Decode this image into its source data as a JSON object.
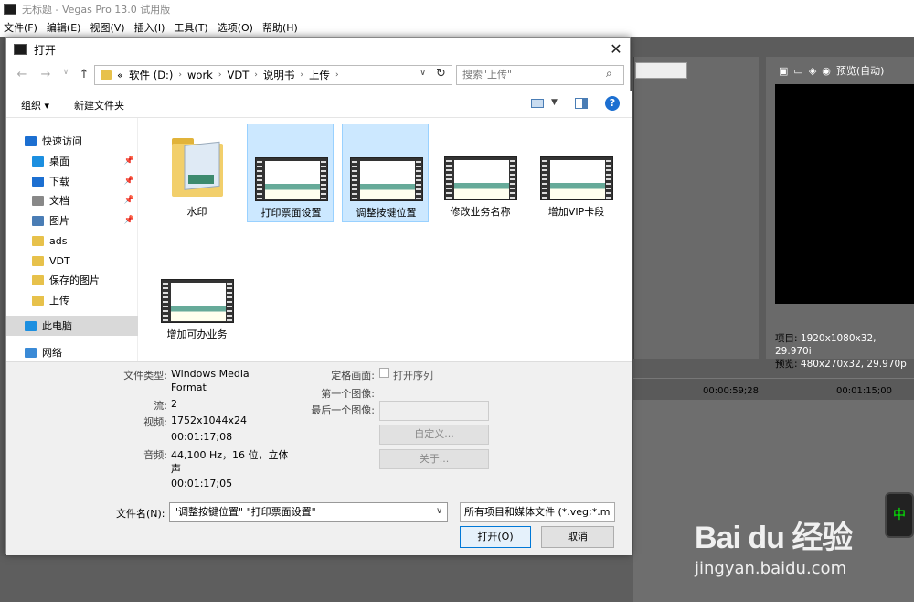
{
  "app": {
    "title": "无标题 - Vegas Pro 13.0 试用版",
    "menu": [
      "文件(F)",
      "编辑(E)",
      "视图(V)",
      "插入(I)",
      "工具(T)",
      "选项(O)",
      "帮助(H)"
    ],
    "preview_label": "预览(自动)",
    "project_label": "项目:",
    "project_value": "1920x1080x32, 29.970i",
    "preview_info_label": "预览:",
    "preview_info_value": "480x270x32, 29.970p",
    "ruler": [
      "00:00:59;28",
      "00:01:15;00"
    ],
    "float_btn": "中"
  },
  "watermark": {
    "brand": "Bai du 经验",
    "url": "jingyan.baidu.com"
  },
  "dialog": {
    "title": "打开",
    "close": "✕",
    "path": [
      "软件 (D:)",
      "work",
      "VDT",
      "说明书",
      "上传"
    ],
    "path_prefix": "«",
    "search_placeholder": "搜索\"上传\"",
    "organize": "组织 ▾",
    "new_folder": "新建文件夹",
    "help": "?",
    "sidebar": [
      {
        "label": "快速访问",
        "color": "#1c6fd1",
        "icon": "star-icon",
        "pin": false,
        "indent": false,
        "selected": false
      },
      {
        "label": "桌面",
        "color": "#1c8fe0",
        "icon": "desktop-icon",
        "pin": true,
        "indent": true,
        "selected": false
      },
      {
        "label": "下载",
        "color": "#1c6fd1",
        "icon": "download-icon",
        "pin": true,
        "indent": true,
        "selected": false
      },
      {
        "label": "文档",
        "color": "#888",
        "icon": "document-icon",
        "pin": true,
        "indent": true,
        "selected": false
      },
      {
        "label": "图片",
        "color": "#4a7db5",
        "icon": "picture-icon",
        "pin": true,
        "indent": true,
        "selected": false
      },
      {
        "label": "ads",
        "color": "#e7c14b",
        "icon": "folder-icon",
        "pin": false,
        "indent": true,
        "selected": false
      },
      {
        "label": "VDT",
        "color": "#e7c14b",
        "icon": "folder-icon",
        "pin": false,
        "indent": true,
        "selected": false
      },
      {
        "label": "保存的图片",
        "color": "#e7c14b",
        "icon": "folder-icon",
        "pin": false,
        "indent": true,
        "selected": false
      },
      {
        "label": "上传",
        "color": "#e7c14b",
        "icon": "folder-icon",
        "pin": false,
        "indent": true,
        "selected": false
      },
      {
        "label": "此电脑",
        "color": "#1c8fe0",
        "icon": "computer-icon",
        "pin": false,
        "indent": false,
        "selected": true
      },
      {
        "label": "网络",
        "color": "#3a8ad6",
        "icon": "network-icon",
        "pin": false,
        "indent": false,
        "selected": false
      }
    ],
    "files": [
      {
        "name": "水印",
        "type": "folder",
        "selected": false
      },
      {
        "name": "打印票面设置",
        "type": "video",
        "selected": true
      },
      {
        "name": "调整按键位置",
        "type": "video",
        "selected": true
      },
      {
        "name": "修改业务名称",
        "type": "video",
        "selected": false
      },
      {
        "name": "增加VIP卡段",
        "type": "video",
        "selected": false
      },
      {
        "name": "增加可办业务",
        "type": "video",
        "selected": false
      }
    ],
    "info": {
      "filetype_label": "文件类型:",
      "filetype_value": "Windows Media",
      "filetype_value2": "Format",
      "stream_label": "流:",
      "stream_value": "2",
      "video_label": "视频:",
      "video_value": "1752x1044x24",
      "video_time": "00:01:17;08",
      "audio_label": "音频:",
      "audio_value": "44,100 Hz，16 位，立体",
      "audio_value2": "声",
      "audio_time": "00:01:17;05",
      "still_label": "定格画面:",
      "still_check_label": "打开序列",
      "first_label": "第一个图像:",
      "last_label": "最后一个图像:",
      "custom_btn": "自定义...",
      "about_btn": "关于..."
    },
    "filename_label": "文件名(N):",
    "filename_value": "\"调整按键位置\" \"打印票面设置\"",
    "filetype_filter": "所有项目和媒体文件 (*.veg;*.m",
    "open_btn": "打开(O)",
    "cancel_btn": "取消"
  }
}
